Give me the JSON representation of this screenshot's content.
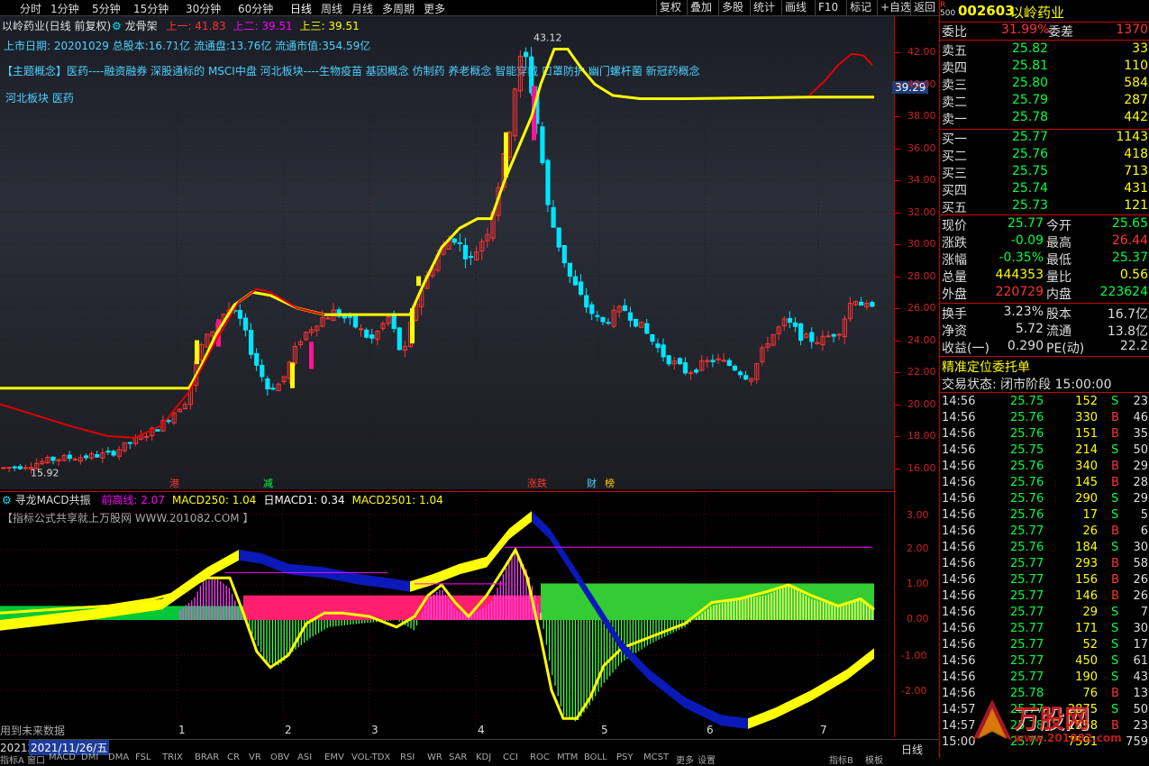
{
  "colors": {
    "up": "#ff3232",
    "down": "#00e5ff",
    "ma": "#ffff00",
    "ma_red": "#e00000",
    "grid": "#7a1010",
    "label": "#dddddd",
    "cyan": "#4dd2ff",
    "green": "#00ff44",
    "magenta": "#ff00ff",
    "yellow": "#ffff00"
  },
  "topbar": {
    "title": "以岭药业(日线 前复权)",
    "indicator_name": "龙骨架",
    "ind_line1": "上一: 41.83",
    "ind_line2": "上二: 39.51",
    "ind_line3": "上三: 39.51",
    "periods": [
      "分时",
      "1分钟",
      "5分钟",
      "15分钟",
      "30分钟",
      "60分钟",
      "日线",
      "周线",
      "月线",
      "多周期",
      "更多"
    ],
    "buttons": [
      "复权",
      "叠加",
      "多股",
      "统计",
      "画线",
      "F10",
      "标记",
      "+自选",
      "返回"
    ]
  },
  "main": {
    "info_line": "上市日期: 20201029 总股本:16.71亿 流通盘:13.76亿 流通市值:354.59亿",
    "concept_line": "【主题概念】医药----融资融券 深股通标的 MSCI中盘 河北板块----生物疫苗 基因概念 仿制药 养老概念 智能穿戴 口罩防护 幽门螺杆菌 新冠药概念",
    "sector_line": "河北板块 医药",
    "high_label": "43.12",
    "low_label": "15.92",
    "current_tag": "39.29",
    "price_ticks": [
      "42.00",
      "40.00",
      "38.00",
      "36.00",
      "34.00",
      "32.00",
      "30.00",
      "28.00",
      "26.00",
      "24.00",
      "22.00",
      "20.00",
      "18.00",
      "16.00"
    ],
    "event_tags": [
      "港",
      "减",
      "涨跌",
      "财",
      "榜"
    ]
  },
  "lower": {
    "ind_title": "寻龙MACD共振",
    "ind_values": [
      {
        "label": "前高线: 2.07",
        "color": "#ff00ff"
      },
      {
        "label": "MACD250: 1.04",
        "color": "#ffff00"
      },
      {
        "label": "日MACD1: 0.34",
        "color": "#ffffff"
      },
      {
        "label": "MACD2501: 1.04",
        "color": "#ffff00"
      }
    ],
    "note": "【指标公式共享就上万股网 WWW.201082.COM 】",
    "future_note": "用到未来数据",
    "ticks": [
      "3.00",
      "2.00",
      "1.00",
      "0.00",
      "-1.00",
      "-2.00"
    ]
  },
  "xaxis": {
    "start_label": "2021/11/26/五",
    "year_prefix": "20212",
    "months": [
      "1",
      "2",
      "3",
      "4",
      "5",
      "6",
      "7"
    ],
    "period": "日线"
  },
  "bottombar": {
    "items": [
      "指标A",
      "窗口",
      "MACD",
      "DMI",
      "DMA",
      "FSL",
      "TRIX",
      "BRAR",
      "CR",
      "VR",
      "OBV",
      "ASI",
      "EMV",
      "VOL-TDX",
      "RSI",
      "WR",
      "SAR",
      "KDJ",
      "CCI",
      "ROC",
      "MTM",
      "BOLL",
      "PSY",
      "MCST",
      "更多",
      "设置"
    ],
    "right_items": [
      "指标B",
      "模板"
    ]
  },
  "quote": {
    "code": "002603",
    "name": "以岭药业",
    "badge_top": "R",
    "badge_bottom": "500",
    "weibi_label": "委比",
    "weibi_value": "31.99%",
    "weicha_label": "委差",
    "weicha_value": "1370",
    "asks": [
      {
        "label": "卖五",
        "price": "25.82",
        "vol": "33"
      },
      {
        "label": "卖四",
        "price": "25.81",
        "vol": "110"
      },
      {
        "label": "卖三",
        "price": "25.80",
        "vol": "584"
      },
      {
        "label": "卖二",
        "price": "25.79",
        "vol": "287"
      },
      {
        "label": "卖一",
        "price": "25.78",
        "vol": "442"
      }
    ],
    "bids": [
      {
        "label": "买一",
        "price": "25.77",
        "vol": "1143"
      },
      {
        "label": "买二",
        "price": "25.76",
        "vol": "418"
      },
      {
        "label": "买三",
        "price": "25.75",
        "vol": "713"
      },
      {
        "label": "买四",
        "price": "25.74",
        "vol": "431"
      },
      {
        "label": "买五",
        "price": "25.73",
        "vol": "121"
      }
    ],
    "stats": [
      {
        "l1": "现价",
        "v1": "25.77",
        "c1": "#00ff44",
        "l2": "今开",
        "v2": "25.65",
        "c2": "#00ff44"
      },
      {
        "l1": "涨跌",
        "v1": "-0.09",
        "c1": "#00ff44",
        "l2": "最高",
        "v2": "26.44",
        "c2": "#ff3232"
      },
      {
        "l1": "涨幅",
        "v1": "-0.35%",
        "c1": "#00ff44",
        "l2": "最低",
        "v2": "25.37",
        "c2": "#00ff44"
      },
      {
        "l1": "总量",
        "v1": "444353",
        "c1": "#ffff00",
        "l2": "量比",
        "v2": "0.56",
        "c2": "#ffff00"
      },
      {
        "l1": "外盘",
        "v1": "220729",
        "c1": "#ff3232",
        "l2": "内盘",
        "v2": "223624",
        "c2": "#00ff44"
      },
      {
        "l1": "换手",
        "v1": "3.23%",
        "c1": "#dddddd",
        "l2": "股本",
        "v2": "16.7亿",
        "c2": "#dddddd"
      },
      {
        "l1": "净资",
        "v1": "5.72",
        "c1": "#dddddd",
        "l2": "流通",
        "v2": "13.8亿",
        "c2": "#dddddd"
      },
      {
        "l1": "收益(一)",
        "v1": "0.290",
        "c1": "#dddddd",
        "l2": "PE(动)",
        "v2": "22.2",
        "c2": "#dddddd"
      }
    ],
    "entrust_title": "精准定位委托单",
    "trade_status": "交易状态: 闭市阶段 15:00:00",
    "ticks": [
      {
        "t": "14:56",
        "p": "25.75",
        "v": "152",
        "bs": "S",
        "n": "23"
      },
      {
        "t": "14:56",
        "p": "25.76",
        "v": "330",
        "bs": "B",
        "n": "46"
      },
      {
        "t": "14:56",
        "p": "25.76",
        "v": "151",
        "bs": "B",
        "n": "35"
      },
      {
        "t": "14:56",
        "p": "25.75",
        "v": "214",
        "bs": "S",
        "n": "50"
      },
      {
        "t": "14:56",
        "p": "25.76",
        "v": "340",
        "bs": "B",
        "n": "29"
      },
      {
        "t": "14:56",
        "p": "25.76",
        "v": "145",
        "bs": "B",
        "n": "28"
      },
      {
        "t": "14:56",
        "p": "25.76",
        "v": "290",
        "bs": "S",
        "n": "29"
      },
      {
        "t": "14:56",
        "p": "25.76",
        "v": "17",
        "bs": "S",
        "n": "5"
      },
      {
        "t": "14:56",
        "p": "25.77",
        "v": "26",
        "bs": "B",
        "n": "6"
      },
      {
        "t": "14:56",
        "p": "25.76",
        "v": "184",
        "bs": "S",
        "n": "30"
      },
      {
        "t": "14:56",
        "p": "25.77",
        "v": "293",
        "bs": "B",
        "n": "58"
      },
      {
        "t": "14:56",
        "p": "25.77",
        "v": "156",
        "bs": "B",
        "n": "26"
      },
      {
        "t": "14:56",
        "p": "25.77",
        "v": "146",
        "bs": "B",
        "n": "26"
      },
      {
        "t": "14:56",
        "p": "25.77",
        "v": "29",
        "bs": "S",
        "n": "7"
      },
      {
        "t": "14:56",
        "p": "25.77",
        "v": "171",
        "bs": "S",
        "n": "30"
      },
      {
        "t": "14:56",
        "p": "25.77",
        "v": "52",
        "bs": "S",
        "n": "17"
      },
      {
        "t": "14:56",
        "p": "25.77",
        "v": "450",
        "bs": "S",
        "n": "61"
      },
      {
        "t": "14:56",
        "p": "25.77",
        "v": "190",
        "bs": "S",
        "n": "43"
      },
      {
        "t": "14:56",
        "p": "25.78",
        "v": "76",
        "bs": "B",
        "n": "13"
      },
      {
        "t": "14:57",
        "p": "25.77",
        "v": "2875",
        "bs": "S",
        "n": "50"
      },
      {
        "t": "14:57",
        "p": "25.78",
        "v": "1558",
        "bs": "B",
        "n": "23"
      },
      {
        "t": "15:00",
        "p": "25.77",
        "v": "7591",
        "bs": "",
        "n": "759"
      }
    ]
  },
  "watermark": {
    "logo": "万股网",
    "url": "www.201082.com"
  }
}
